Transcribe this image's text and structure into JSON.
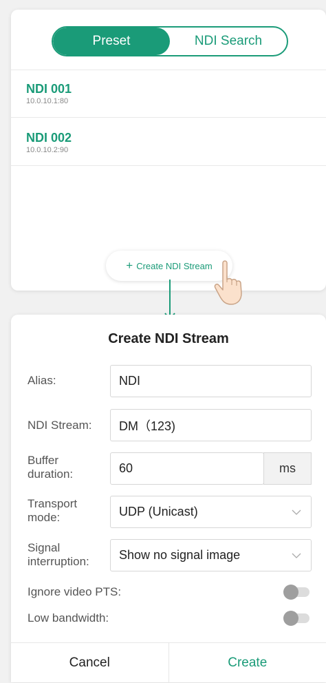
{
  "tabs": {
    "preset": "Preset",
    "ndi_search": "NDI Search"
  },
  "ndi_list": [
    {
      "name": "NDI 001",
      "address": "10.0.10.1:80"
    },
    {
      "name": "NDI 002",
      "address": "10.0.10.2:90"
    }
  ],
  "create_button": {
    "icon": "plus-icon",
    "label": "Create NDI Stream"
  },
  "dialog": {
    "title": "Create NDI Stream",
    "alias": {
      "label": "Alias:",
      "value": "NDI"
    },
    "ndi_stream": {
      "label": "NDI Stream:",
      "value": "DM（123)"
    },
    "buffer_duration": {
      "label_line1": "Buffer",
      "label_line2": "duration:",
      "value": "60",
      "unit": "ms"
    },
    "transport_mode": {
      "label_line1": "Transport",
      "label_line2": "mode:",
      "value": "UDP (Unicast)"
    },
    "signal_interruption": {
      "label_line1": "Signal",
      "label_line2": "interruption:",
      "value": "Show no signal image"
    },
    "ignore_video_pts": {
      "label": "Ignore video PTS:",
      "on": false
    },
    "low_bandwidth": {
      "label": "Low bandwidth:",
      "on": false
    },
    "cancel": "Cancel",
    "create": "Create"
  },
  "colors": {
    "accent": "#1a9b78",
    "background": "#f1f1f1"
  }
}
